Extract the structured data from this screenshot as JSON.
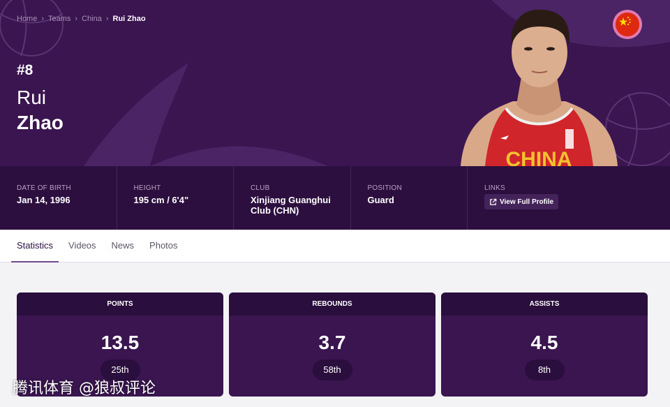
{
  "breadcrumb": {
    "home": "Home",
    "teams": "Teams",
    "country": "China",
    "current": "Rui Zhao"
  },
  "player": {
    "number": "#8",
    "first_name": "Rui",
    "last_name": "Zhao",
    "jersey_text": "CHINA"
  },
  "info": [
    {
      "label": "DATE OF BIRTH",
      "value": "Jan 14, 1996"
    },
    {
      "label": "HEIGHT",
      "value": "195 cm / 6'4\""
    },
    {
      "label": "CLUB",
      "value": "Xinjiang Guanghui Club (CHN)"
    },
    {
      "label": "POSITION",
      "value": "Guard"
    },
    {
      "label": "LINKS",
      "link_label": "View Full Profile"
    }
  ],
  "tabs": [
    "Statistics",
    "Videos",
    "News",
    "Photos"
  ],
  "stats": [
    {
      "label": "POINTS",
      "value": "13.5",
      "rank": "25th"
    },
    {
      "label": "REBOUNDS",
      "value": "3.7",
      "rank": "58th"
    },
    {
      "label": "ASSISTS",
      "value": "4.5",
      "rank": "8th"
    }
  ],
  "watermark": "腾讯体育 @狼叔评论",
  "colors": {
    "hero": "#3a1550",
    "info_bar": "#2c0f3f",
    "card": "#3a1550",
    "card_head": "#2a0e3d",
    "flag_red": "#de2910",
    "flag_star": "#ffde00"
  },
  "icons": {
    "breadcrumb_separator": "chevron-right-icon",
    "link": "external-link-icon",
    "flag": "china-flag-icon"
  }
}
